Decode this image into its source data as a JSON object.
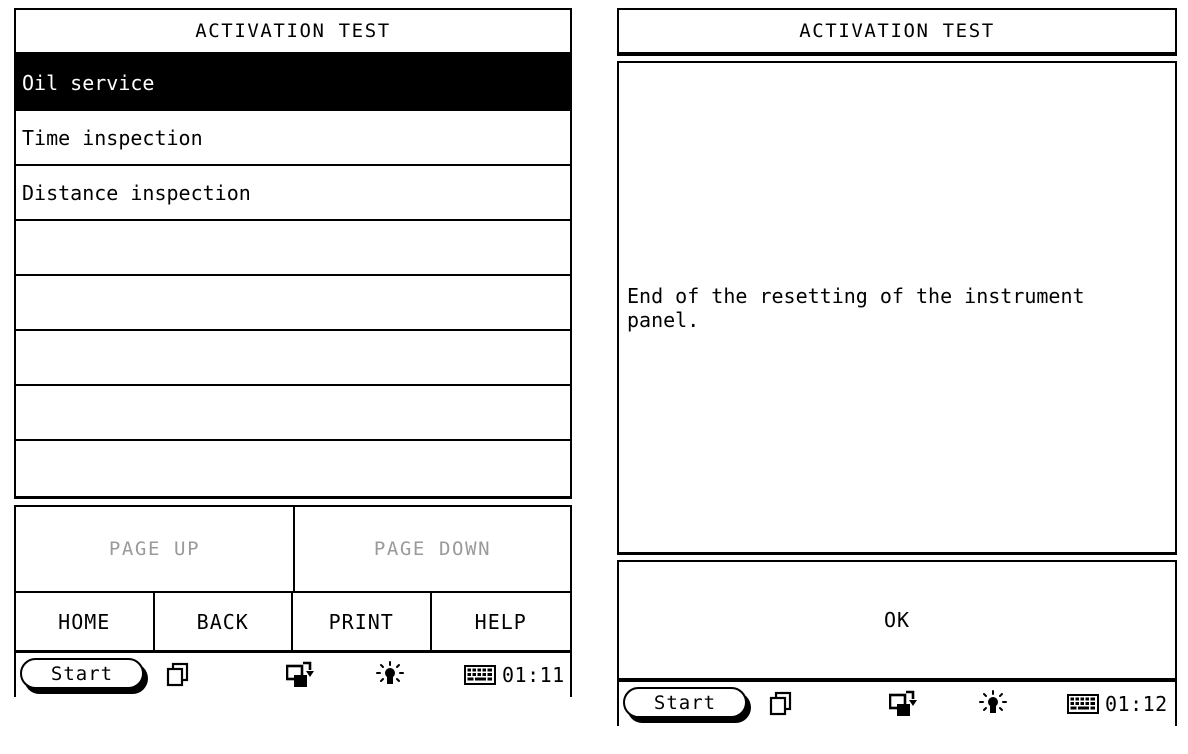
{
  "left_panel": {
    "title": "ACTIVATION TEST",
    "list": {
      "rows": [
        {
          "label": "Oil service",
          "selected": true
        },
        {
          "label": "Time inspection",
          "selected": false
        },
        {
          "label": "Distance inspection",
          "selected": false
        },
        {
          "label": "",
          "selected": false
        },
        {
          "label": "",
          "selected": false
        },
        {
          "label": "",
          "selected": false
        },
        {
          "label": "",
          "selected": false
        },
        {
          "label": "",
          "selected": false
        }
      ]
    },
    "paging": {
      "page_up_label": "PAGE UP",
      "page_down_label": "PAGE DOWN",
      "disabled_color": "#9a9a9a"
    },
    "nav": {
      "home_label": "HOME",
      "back_label": "BACK",
      "print_label": "PRINT",
      "help_label": "HELP"
    },
    "taskbar": {
      "start_label": "Start",
      "clock": "01:11",
      "icons": [
        "task-switcher-icon",
        "screen-rotate-icon",
        "brightness-icon",
        "keyboard-icon"
      ]
    }
  },
  "right_panel": {
    "title": "ACTIVATION TEST",
    "message": "End of the resetting of the instrument\npanel.",
    "ok_label": "OK",
    "taskbar": {
      "start_label": "Start",
      "clock": "01:12",
      "icons": [
        "task-switcher-icon",
        "screen-rotate-icon",
        "brightness-icon",
        "keyboard-icon"
      ]
    }
  },
  "theme": {
    "foreground": "#000000",
    "background": "#ffffff",
    "selection_bg": "#000000",
    "selection_fg": "#ffffff",
    "disabled_fg": "#9a9a9a"
  }
}
